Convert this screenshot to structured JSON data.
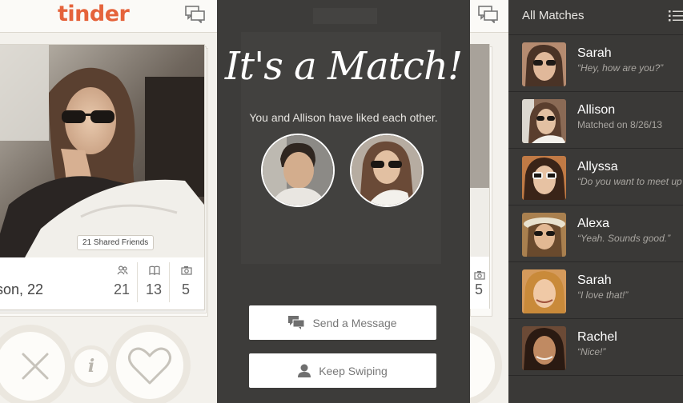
{
  "swipe": {
    "logo": "tinder",
    "shared_friends": "21 Shared Friends",
    "name": "ison",
    "age": ", 22",
    "stats": [
      {
        "icon": "friends-icon",
        "value": "21"
      },
      {
        "icon": "book-icon",
        "value": "13"
      },
      {
        "icon": "camera-icon",
        "value": "5"
      }
    ],
    "info_glyph": "i"
  },
  "match": {
    "title": "It's a Match!",
    "subtitle": "You and Allison have liked each other.",
    "send_label": "Send a Message",
    "keep_label": "Keep Swiping"
  },
  "sliver": {
    "stat_value": "5"
  },
  "matches": {
    "title": "All Matches",
    "items": [
      {
        "name": "Sarah",
        "message": "“Hey, how are you?”",
        "quoted": true,
        "color": "#b58b70"
      },
      {
        "name": "Allison",
        "message": "Matched on 8/26/13",
        "quoted": false,
        "color": "#8a6a55"
      },
      {
        "name": "Allyssa",
        "message": "“Do you want to meet up",
        "quoted": true,
        "color": "#c07a45"
      },
      {
        "name": "Alexa",
        "message": "“Yeah. Sounds good.”",
        "quoted": true,
        "color": "#a9804f"
      },
      {
        "name": "Sarah",
        "message": "“I love that!”",
        "quoted": true,
        "color": "#d59a5b"
      },
      {
        "name": "Rachel",
        "message": "“Nice!”",
        "quoted": true,
        "color": "#6b4a36"
      }
    ]
  },
  "colors": {
    "brand": "#e5633b",
    "dark_panel": "#3d3c3a",
    "list_panel": "#3a3937"
  }
}
